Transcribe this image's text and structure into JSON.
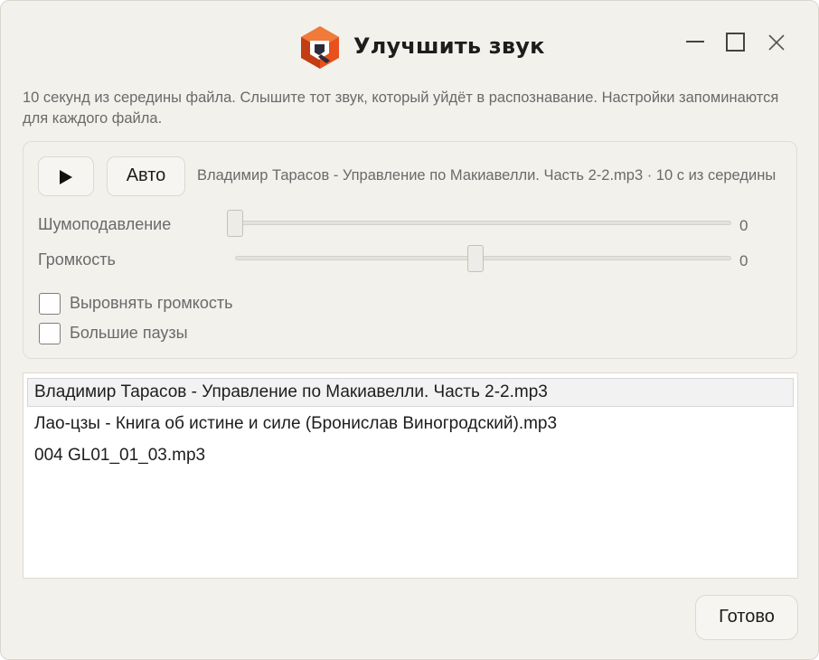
{
  "window": {
    "title": "Улучшить звук",
    "logo_icon": "app-logo-q",
    "controls": [
      "minimize-icon",
      "maximize-icon",
      "close-icon"
    ]
  },
  "description": "10 секунд из середины файла. Слышите тот звук, который уйдёт в распознавание. Настройки запоминаются для каждого файла.",
  "player": {
    "play_icon": "play-icon",
    "auto_label": "Авто",
    "file_info": "Владимир Тарасов - Управление по Макиавелли. Часть 2-2.mp3 · 10 с из середины"
  },
  "sliders": {
    "noise": {
      "label": "Шумоподавление",
      "value": "0",
      "level": 0.0
    },
    "volume": {
      "label": "Громкость",
      "value": "0",
      "level": 0.5
    }
  },
  "checkboxes": {
    "normalize": {
      "label": "Выровнять громкость",
      "checked": false
    },
    "long_pauses": {
      "label": "Большие паузы",
      "checked": false
    }
  },
  "files": [
    {
      "name": "Владимир Тарасов - Управление по Макиавелли. Часть 2-2.mp3",
      "selected": true
    },
    {
      "name": "Лао-цзы - Книга об истине и силе (Бронислав Виногродский).mp3",
      "selected": false
    },
    {
      "name": "004 GL01_01_03.mp3",
      "selected": false
    }
  ],
  "done_label": "Готово",
  "colors": {
    "window_bg": "#f3f1ec",
    "text_primary": "#1d1d1d",
    "text_secondary": "#6a6a6a",
    "logo_orange": "#e8501e",
    "logo_dark": "#2b2b3a"
  }
}
